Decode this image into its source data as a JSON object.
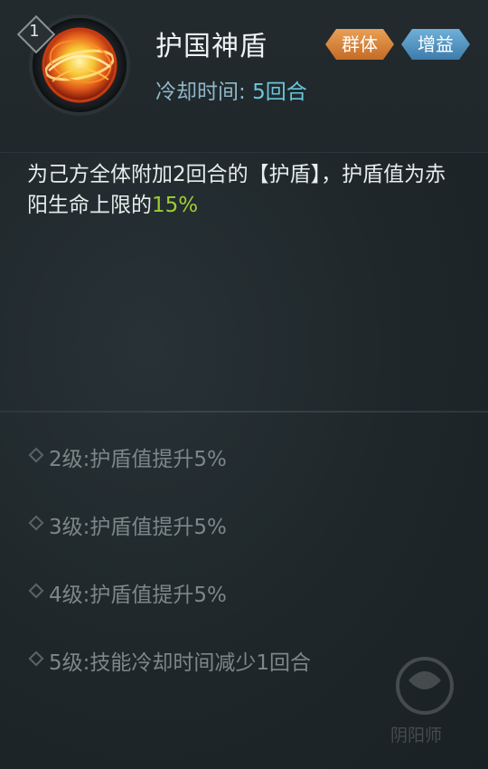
{
  "skill": {
    "level": "1",
    "name": "护国神盾",
    "cooldown_label": "冷却时间:",
    "cooldown_value": "5回合",
    "icon": "golden-shield-orb-icon",
    "tags": [
      {
        "label": "群体",
        "color": "#d9843c"
      },
      {
        "label": "增益",
        "color": "#4f92c2"
      }
    ]
  },
  "description": {
    "text": "为己方全体附加2回合的【护盾】，护盾值为赤阳生命上限的",
    "highlight": "15%",
    "highlight_color": "#9ccf33"
  },
  "upgrades": [
    {
      "text": "2级:护盾值提升5%"
    },
    {
      "text": "3级:护盾值提升5%"
    },
    {
      "text": "4级:护盾值提升5%"
    },
    {
      "text": "5级:技能冷却时间减少1回合"
    }
  ],
  "watermark": {
    "text": "阴阳师"
  }
}
